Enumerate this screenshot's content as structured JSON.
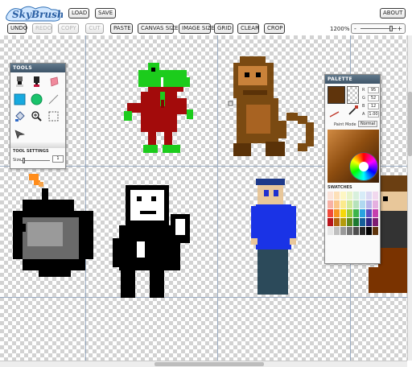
{
  "app": {
    "logo_text": "SkyBrush"
  },
  "header": {
    "load_label": "LOAD",
    "save_label": "SAVE",
    "about_label": "ABOUT"
  },
  "toolbar": {
    "undo": "UNDO",
    "redo": "REDO",
    "copy": "COPY",
    "cut": "CUT",
    "paste": "PASTE",
    "canvas_size": "CANVAS SIZE",
    "image_size": "IMAGE SIZE",
    "grid": "GRID",
    "clear": "CLEAR",
    "crop": "CROP",
    "zoom_label": "1200%",
    "zoom_minus": "-",
    "zoom_plus": "+"
  },
  "tools_panel": {
    "title": "TOOLS",
    "tools": [
      "brush",
      "pencil",
      "eraser",
      "rectangle",
      "ellipse",
      "line",
      "fill",
      "zoom",
      "select",
      "eyedropper"
    ],
    "settings_label": "TOOL SETTINGS",
    "size_label": "Size",
    "size_value": "1"
  },
  "palette_panel": {
    "title": "PALETTE",
    "rgba": [
      {
        "label": "R",
        "value": "95"
      },
      {
        "label": "G",
        "value": "52"
      },
      {
        "label": "B",
        "value": "12"
      },
      {
        "label": "A",
        "value": "1.00"
      }
    ],
    "paint_mode_label": "Paint Mode",
    "paint_mode_value": "Normal",
    "swatches_label": "SWATCHES",
    "current_color": "#5f340c"
  }
}
